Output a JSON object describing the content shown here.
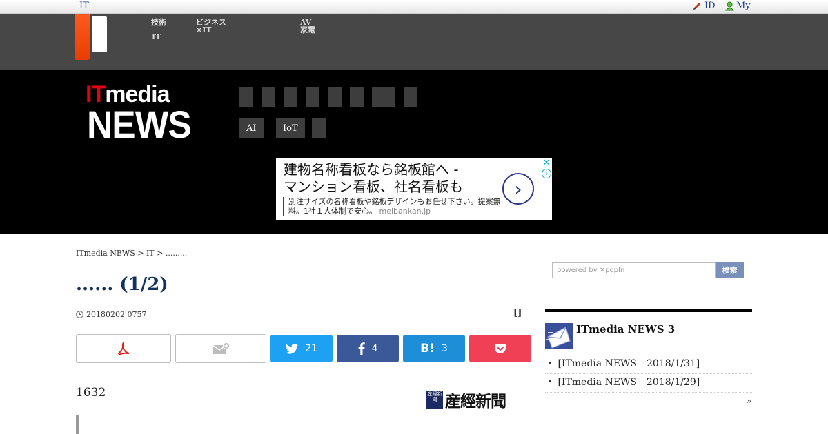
{
  "topbar": {
    "site": "IT",
    "id_label": "ID",
    "my_label": "My"
  },
  "gnav": {
    "items": [
      "技術",
      "IT",
      "ビジネス",
      "×IT",
      "AV",
      "家電"
    ]
  },
  "header": {
    "logo_it": "IT",
    "logo_media": "media",
    "logo_news": "NEWS",
    "tags": [
      "AI",
      "IoT"
    ]
  },
  "ad": {
    "headline1": "建物名称看板なら銘板館へ -",
    "headline2": "マンション看板、社名看板も",
    "description": "別注サイズの名称看板や銘板デザインもお任せ下さい。提案無料。1社１人体制で安心。",
    "domain": "meibankan.jp",
    "close": "✕",
    "info": "i",
    "arrow": "›"
  },
  "article": {
    "breadcrumb": "ITmedia NEWS > IT > .........",
    "title": "...... (1/2)",
    "date": "20180202 0757",
    "bracket": "[]",
    "lead": "1632",
    "source": "産經新聞",
    "source_mark": "産経新聞"
  },
  "share": {
    "twitter_count": "21",
    "facebook_count": "4",
    "hatena_count": "3",
    "hatena_label": "B!"
  },
  "colors": {
    "twitter": "#1da1f2",
    "facebook": "#3b5998",
    "hatena": "#1e8ed9",
    "pocket": "#ef4056",
    "pdf": "#e0241b",
    "brand_orange": "#ff5a1f",
    "title_navy": "#13335f"
  },
  "sidebar": {
    "search_placeholder": "powered by ✕popIn",
    "search_button": "検索",
    "newsletter_title": "ITmedia NEWS 3",
    "items": [
      "・ [ITmedia NEWS　2018/1/31]",
      "・ [ITmedia NEWS　2018/1/29]"
    ],
    "more": "»"
  }
}
